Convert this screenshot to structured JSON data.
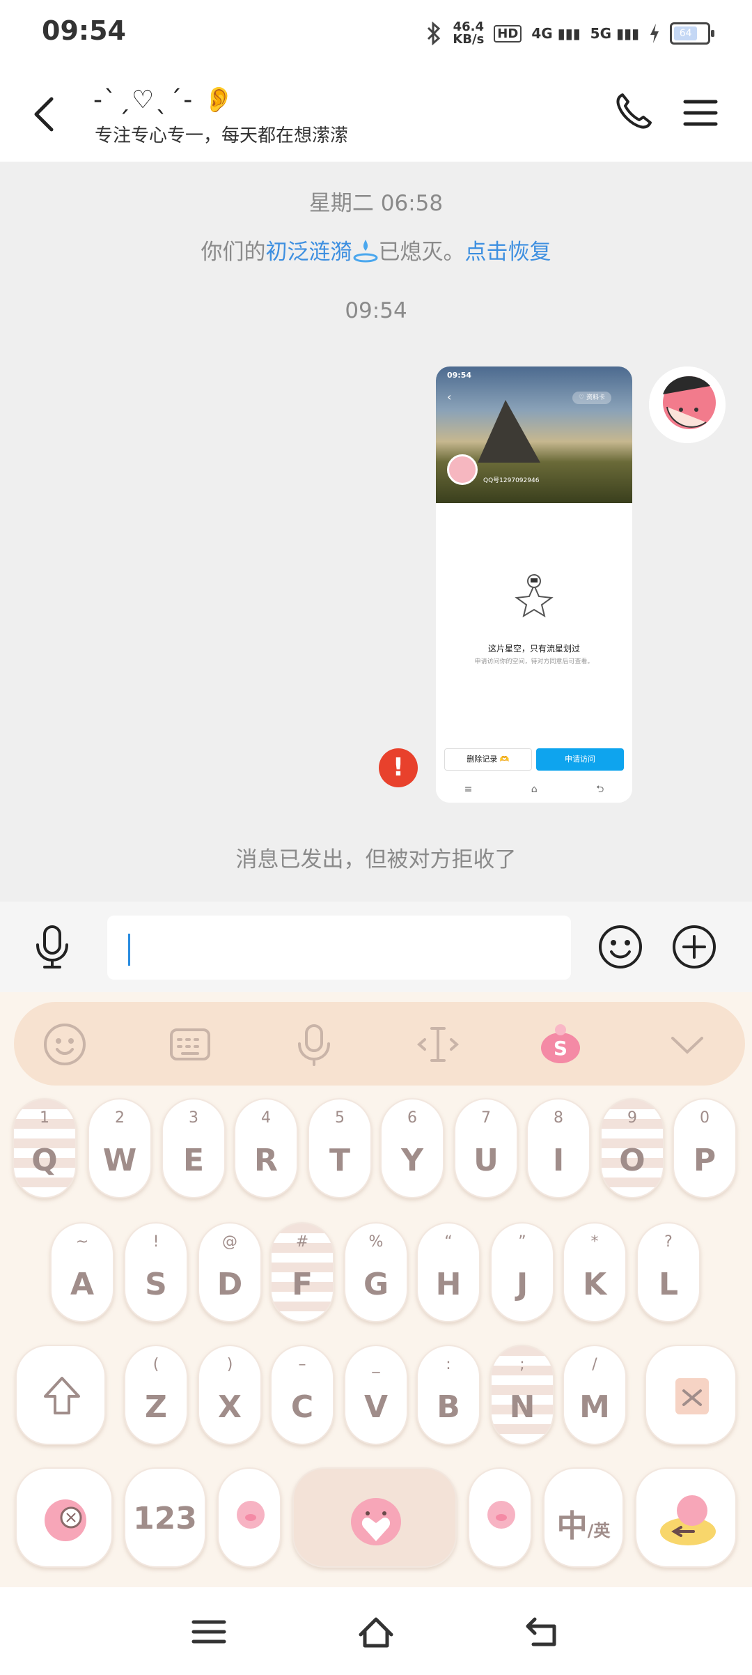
{
  "status_bar": {
    "time": "09:54",
    "net_speed_value": "46.4",
    "net_speed_unit": "KB/s",
    "hd_label": "HD",
    "signal_1": "4G",
    "signal_2": "5G",
    "battery_label": "64"
  },
  "header": {
    "contact_name": "-ˋˏ♡ˎˊ- 👂",
    "contact_status": "专注专心专一，每天都在想潆潆"
  },
  "chat": {
    "timestamp_1": "星期二 06:58",
    "notice_prefix": "你们的",
    "notice_spark_name": "初泛涟漪",
    "notice_middle": "已熄灭。",
    "notice_link": "点击恢复",
    "timestamp_2": "09:54",
    "rejected_note": "消息已发出，但被对方拒收了",
    "error_mark": "!",
    "screenshot": {
      "time": "09:54",
      "pill": "♡ 资料卡",
      "qq_id": "QQ号1297092946",
      "title": "这片星空，只有流星划过",
      "subtitle": "申请访问你的空间，待对方同意后可查看。",
      "btn_delete": "删除记录 🫶",
      "btn_apply": "申请访问",
      "nav_icons": "≡ ⌂ ⮌"
    }
  },
  "keyboard": {
    "rows": [
      [
        {
          "hint": "1",
          "key": "Q"
        },
        {
          "hint": "2",
          "key": "W"
        },
        {
          "hint": "3",
          "key": "E"
        },
        {
          "hint": "4",
          "key": "R"
        },
        {
          "hint": "5",
          "key": "T"
        },
        {
          "hint": "6",
          "key": "Y"
        },
        {
          "hint": "7",
          "key": "U"
        },
        {
          "hint": "8",
          "key": "I"
        },
        {
          "hint": "9",
          "key": "O"
        },
        {
          "hint": "0",
          "key": "P"
        }
      ],
      [
        {
          "hint": "~",
          "key": "A"
        },
        {
          "hint": "!",
          "key": "S"
        },
        {
          "hint": "@",
          "key": "D"
        },
        {
          "hint": "#",
          "key": "F"
        },
        {
          "hint": "%",
          "key": "G"
        },
        {
          "hint": "“",
          "key": "H"
        },
        {
          "hint": "”",
          "key": "J"
        },
        {
          "hint": "*",
          "key": "K"
        },
        {
          "hint": "?",
          "key": "L"
        }
      ],
      [
        {
          "hint": "(",
          "key": "Z"
        },
        {
          "hint": ")",
          "key": "X"
        },
        {
          "hint": "–",
          "key": "C"
        },
        {
          "hint": "_",
          "key": "V"
        },
        {
          "hint": ":",
          "key": "B"
        },
        {
          "hint": ";",
          "key": "N"
        },
        {
          "hint": "/",
          "key": "M"
        }
      ]
    ],
    "num_key": "123",
    "lang_key": "中/英",
    "lang_main": "中",
    "lang_sub": "/英"
  },
  "colors": {
    "accent_link": "#3d8fe0",
    "error_red": "#e8412c",
    "key_text": "#a08d8a",
    "toolbar_bg": "#f7e2d0"
  }
}
